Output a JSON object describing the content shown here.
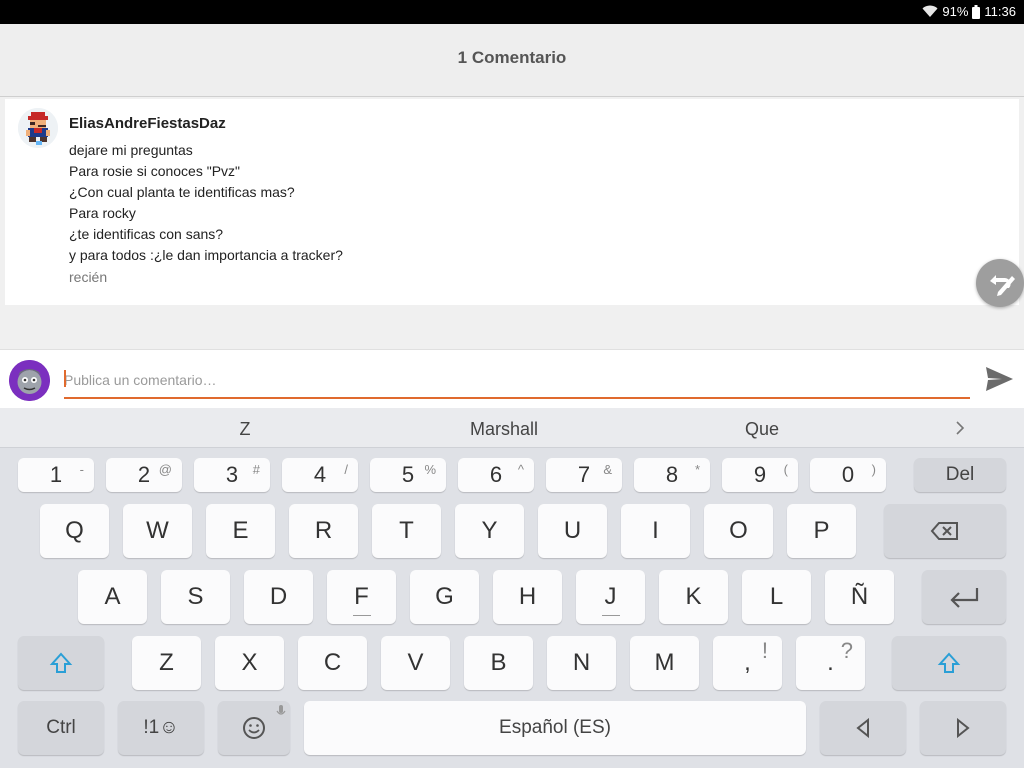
{
  "status_bar": {
    "battery": "91%",
    "time": "11:36",
    "icons": [
      "wifi-icon",
      "battery-icon"
    ]
  },
  "header": {
    "title": "1 Comentario"
  },
  "comment": {
    "author": "EliasAndreFiestasDaz",
    "lines": [
      "dejare mi preguntas",
      "Para rosie si conoces \"Pvz\"",
      "¿Con cual planta te identificas mas?",
      "Para rocky",
      "¿te identificas con sans?",
      "y para todos :¿le dan importancia a tracker?"
    ],
    "time": "recién"
  },
  "composer": {
    "placeholder": "Publica un comentario…",
    "value": ""
  },
  "keyboard": {
    "suggestions": [
      "Z",
      "Marshall",
      "Que"
    ],
    "number_row": [
      {
        "label": "1",
        "hint": "-"
      },
      {
        "label": "2",
        "hint": "@"
      },
      {
        "label": "3",
        "hint": "#"
      },
      {
        "label": "4",
        "hint": "/"
      },
      {
        "label": "5",
        "hint": "%"
      },
      {
        "label": "6",
        "hint": "^"
      },
      {
        "label": "7",
        "hint": "&"
      },
      {
        "label": "8",
        "hint": "*"
      },
      {
        "label": "9",
        "hint": "("
      },
      {
        "label": "0",
        "hint": ")"
      }
    ],
    "del_label": "Del",
    "row1": [
      "Q",
      "W",
      "E",
      "R",
      "T",
      "Y",
      "U",
      "I",
      "O",
      "P"
    ],
    "row2": [
      "A",
      "S",
      "D",
      "F",
      "G",
      "H",
      "J",
      "K",
      "L",
      "Ñ"
    ],
    "row3": [
      "Z",
      "X",
      "C",
      "V",
      "B",
      "N",
      "M"
    ],
    "comma": {
      "label": ",",
      "hint": "!"
    },
    "period": {
      "label": ".",
      "hint": "?"
    },
    "ctrl_label": "Ctrl",
    "symbols_label": "!1☺",
    "space_label": "Español (ES)",
    "accent_color": "#2a9fd6"
  }
}
